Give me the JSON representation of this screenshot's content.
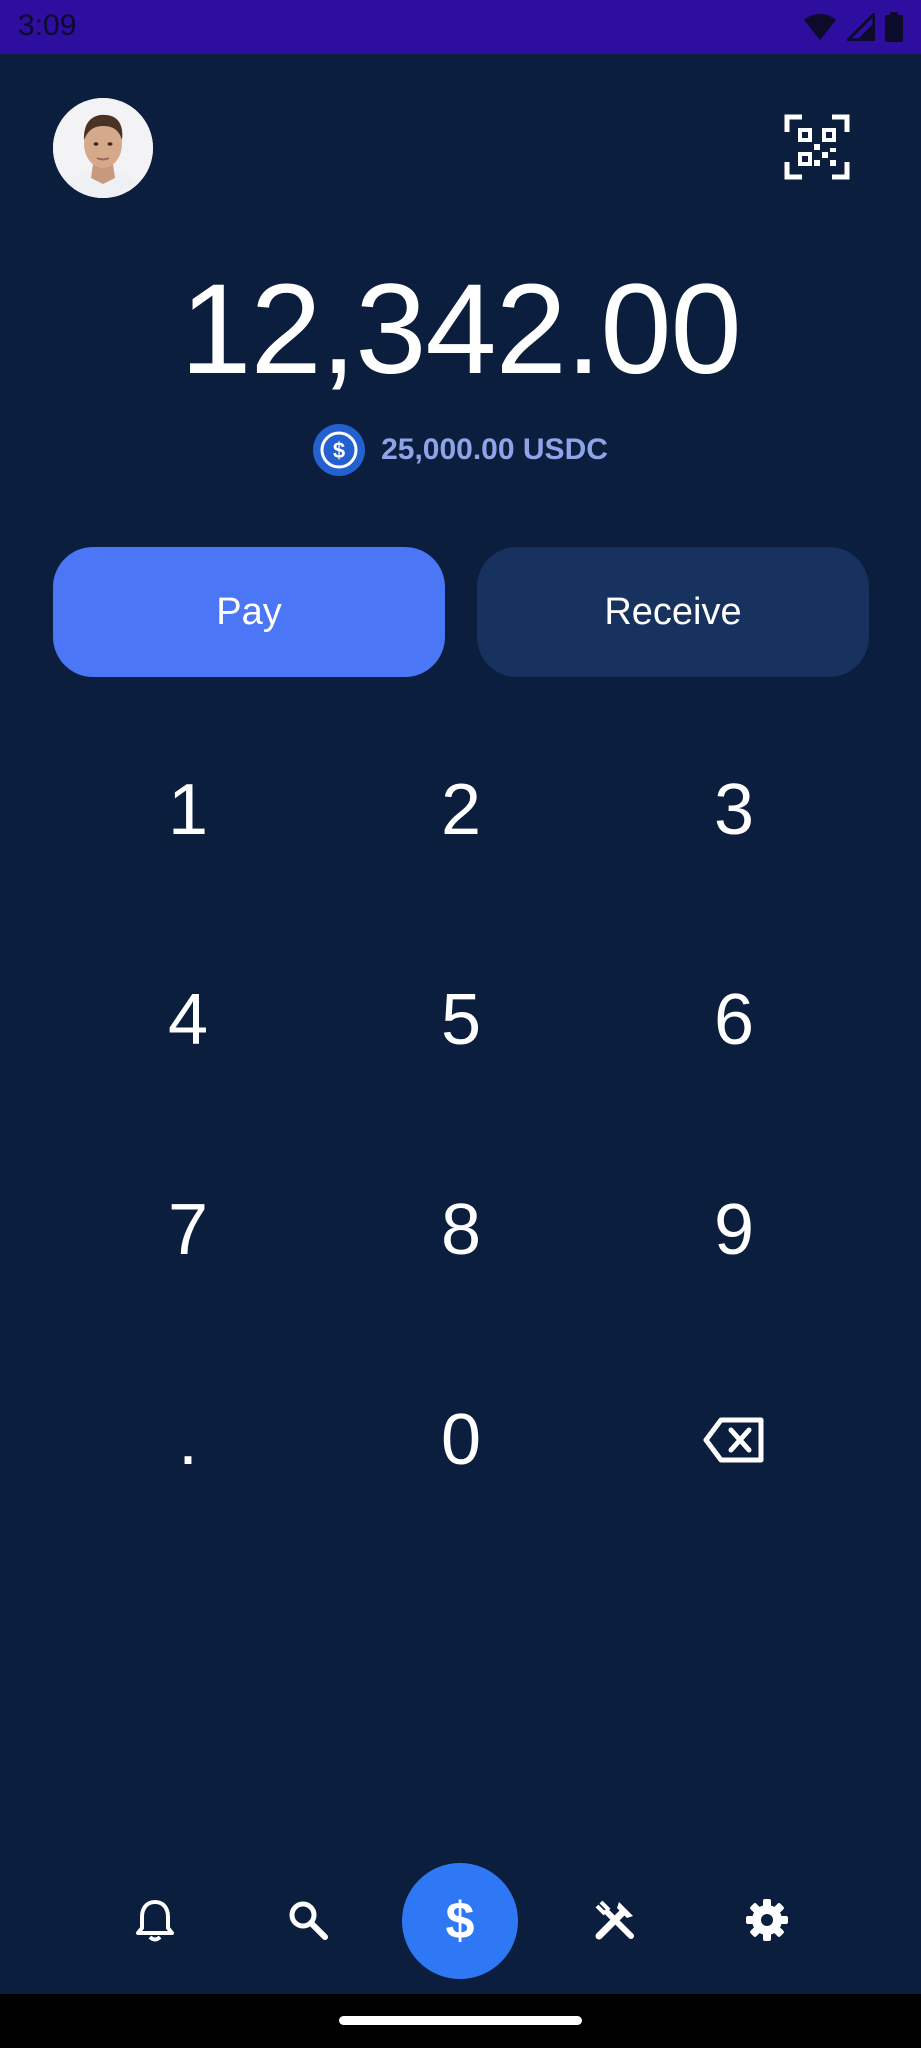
{
  "status_bar": {
    "time": "3:09"
  },
  "header": {
    "avatar_icon": "user-avatar",
    "qr_icon": "qr-code-icon"
  },
  "balance": {
    "amount": "12,342.00",
    "usdc_amount": "25,000.00 USDC"
  },
  "actions": {
    "pay_label": "Pay",
    "receive_label": "Receive"
  },
  "keypad": {
    "keys": [
      "1",
      "2",
      "3",
      "4",
      "5",
      "6",
      "7",
      "8",
      "9",
      ".",
      "0"
    ],
    "backspace_icon": "backspace-icon"
  },
  "bottom_nav": {
    "items": [
      "bell-icon",
      "search-icon",
      "dollar-icon",
      "tools-icon",
      "gear-icon"
    ],
    "pay_symbol": "$"
  },
  "colors": {
    "background": "#0c1e3d",
    "status_bar": "#2d0e9e",
    "pay_button": "#4b76f5",
    "receive_button": "#17325f",
    "usdc_text": "#8fa4e8",
    "nav_pay": "#2f78f5"
  }
}
